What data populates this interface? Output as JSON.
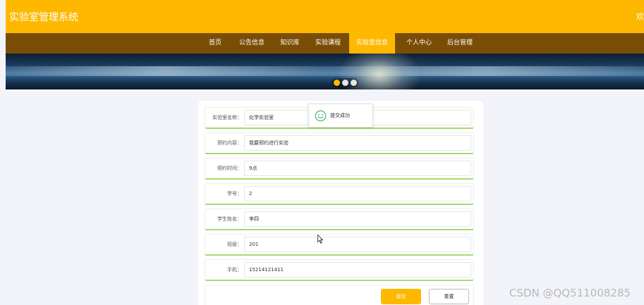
{
  "header": {
    "app_title": "实验室管理系统",
    "welcome_text": "欢"
  },
  "nav": {
    "items": [
      {
        "label": "首页"
      },
      {
        "label": "公告信息"
      },
      {
        "label": "知识库"
      },
      {
        "label": "实验课程"
      },
      {
        "label": "实验室信息"
      },
      {
        "label": "个人中心"
      },
      {
        "label": "后台管理"
      }
    ],
    "active": "实验室信息"
  },
  "banner": {
    "slide_count": 3,
    "active_slide": 1
  },
  "form": {
    "fields": [
      {
        "label": "实验室名称：",
        "value": "化学实验室"
      },
      {
        "label": "预约内容：",
        "value": "我要预约进行实验"
      },
      {
        "label": "预约时间：",
        "value": "9点"
      },
      {
        "label": "学号：",
        "value": "2"
      },
      {
        "label": "学生姓名：",
        "value": "李四"
      },
      {
        "label": "班级：",
        "value": "201"
      },
      {
        "label": "手机：",
        "value": "15214121411"
      }
    ],
    "submit_label": "提交",
    "reset_label": "重置"
  },
  "toast": {
    "icon": "smile-icon",
    "message": "提交成功"
  },
  "watermark": "CSDN @QQ511008285",
  "colors": {
    "accent": "#ffb800",
    "nav_background": "#7a4d06",
    "field_underline": "#a6db6f",
    "page_background": "#f3f4fa",
    "toast_icon": "#5fb878"
  }
}
